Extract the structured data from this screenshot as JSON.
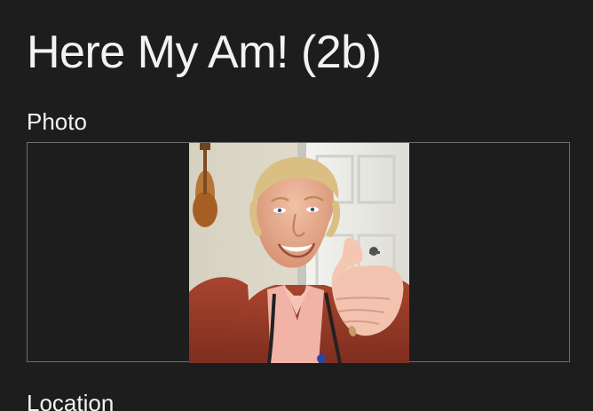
{
  "app": {
    "title": "Here My Am! (2b)"
  },
  "photo_section": {
    "label": "Photo",
    "image_alt": "Photo"
  },
  "location_section": {
    "label": "Location"
  }
}
